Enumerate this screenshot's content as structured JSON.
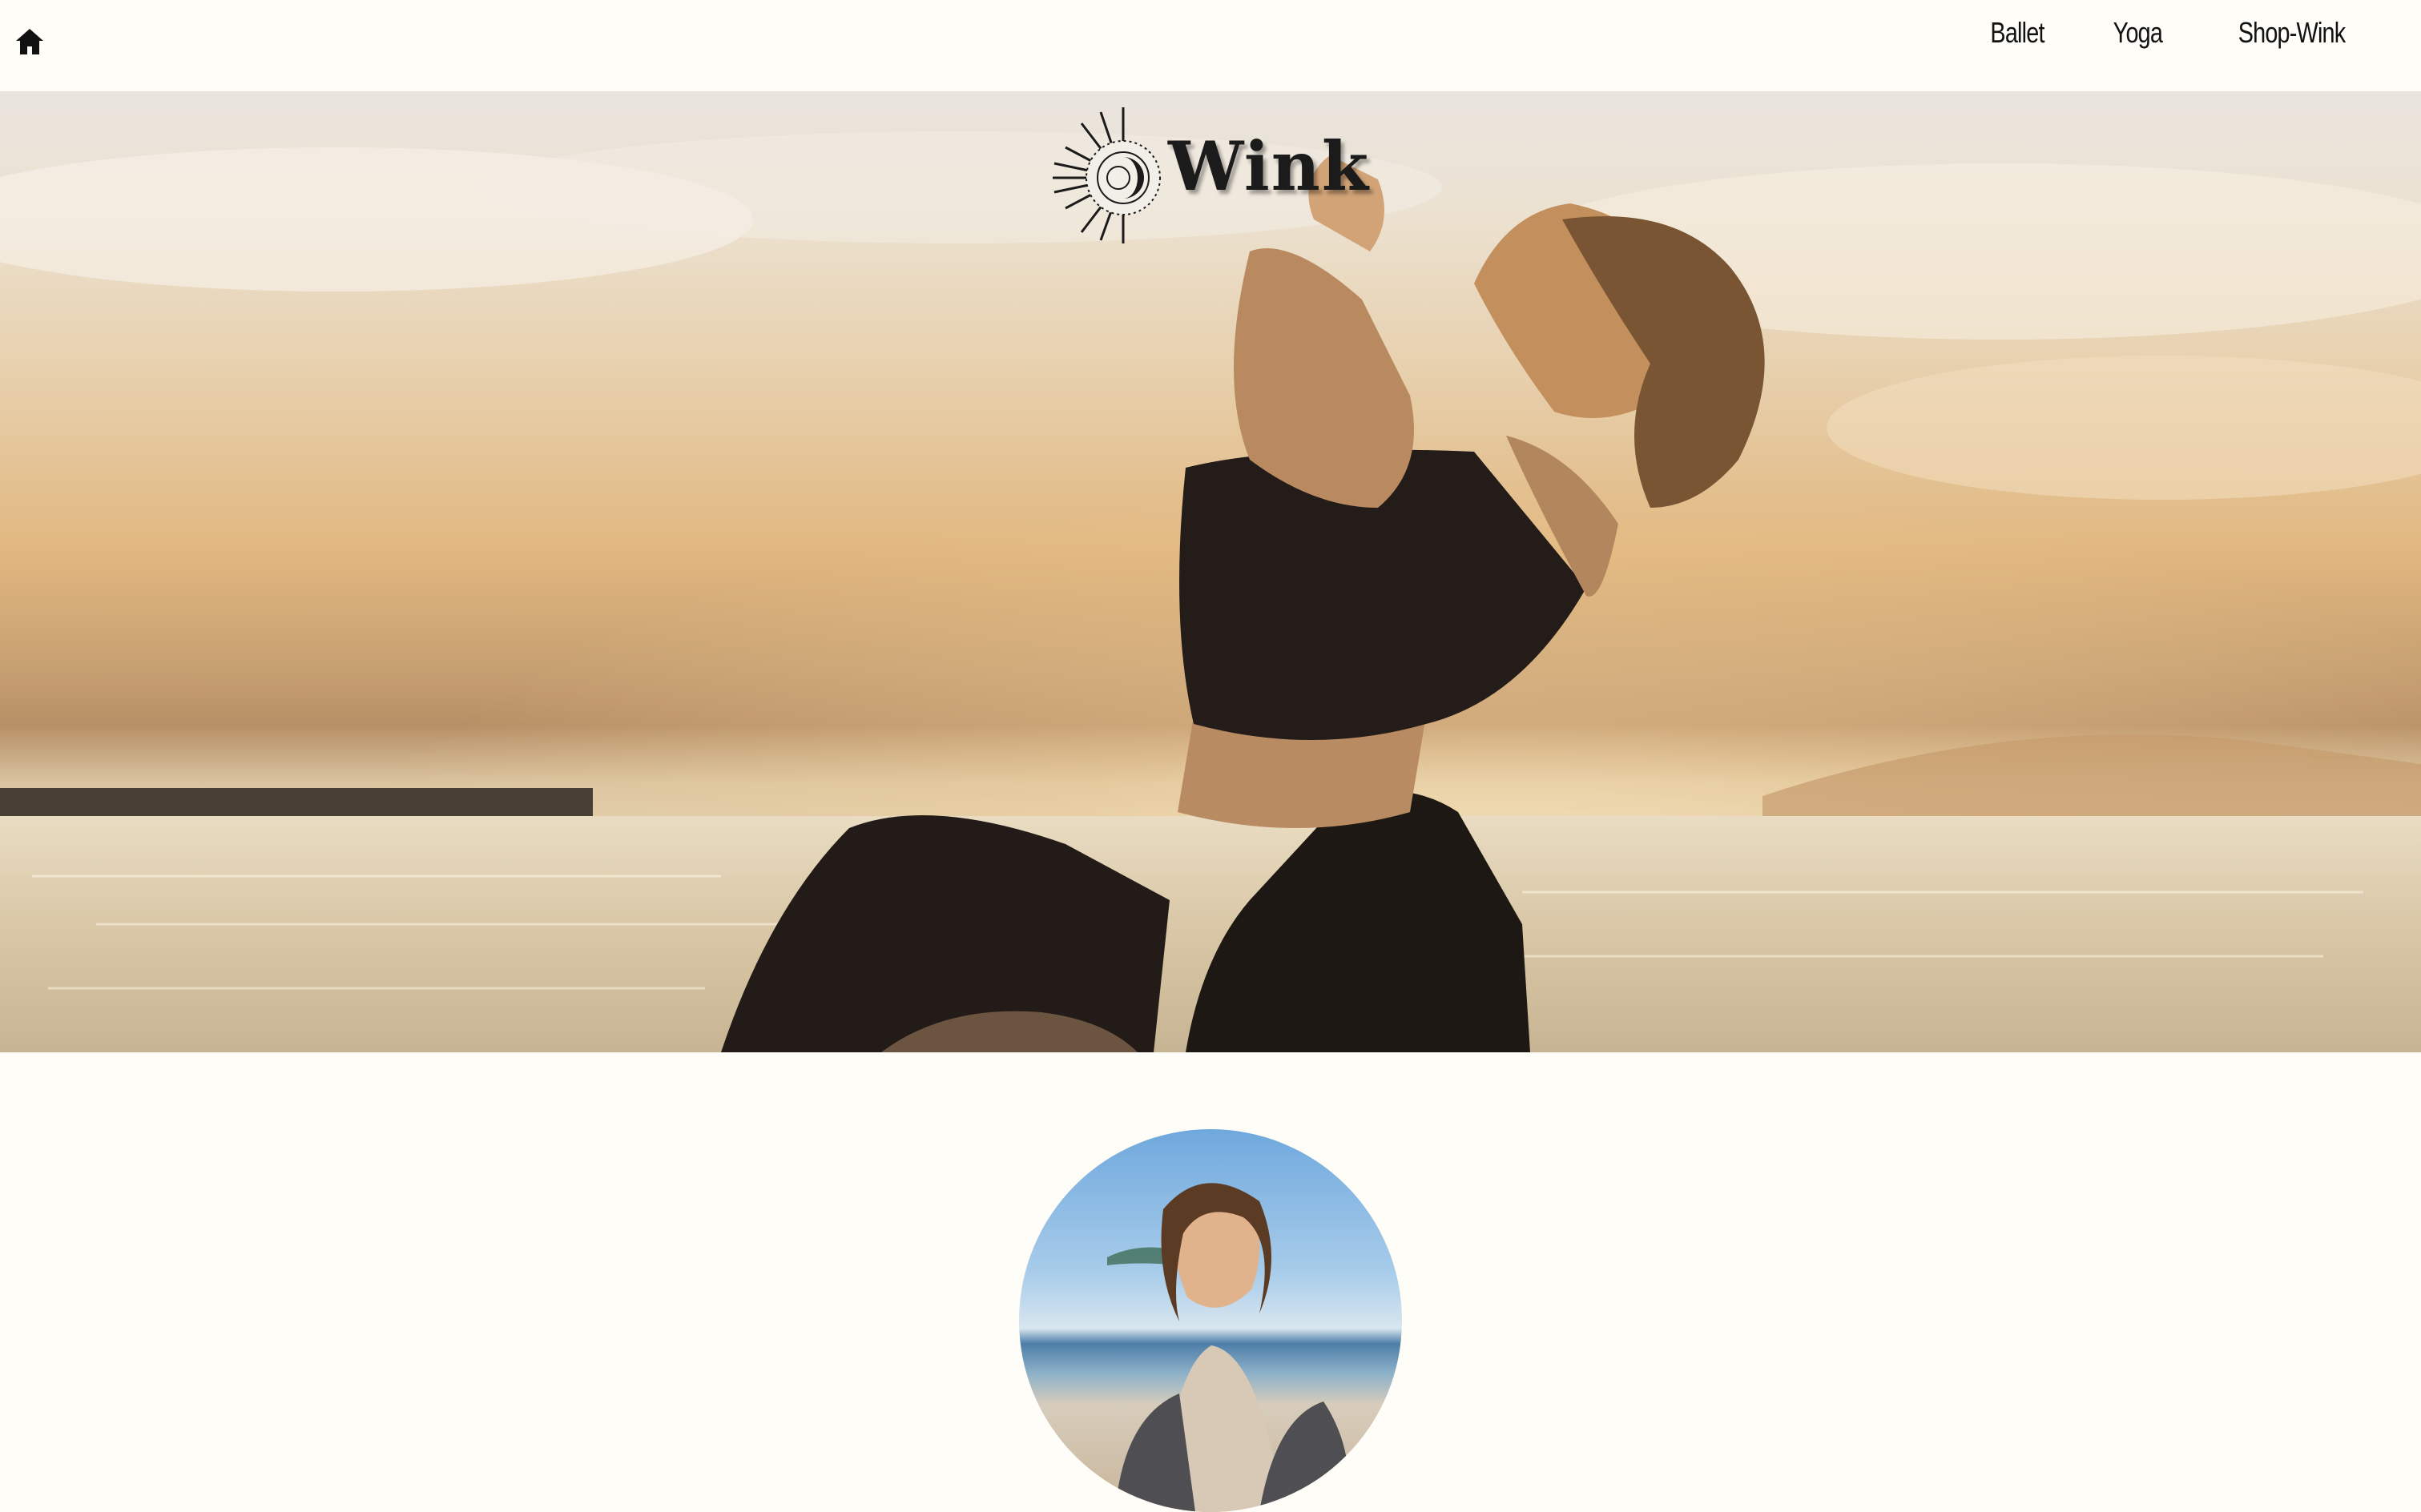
{
  "header": {
    "home_icon": "home-icon",
    "nav": [
      {
        "label": "Ballet"
      },
      {
        "label": "Yoga"
      },
      {
        "label": "Shop-Wink"
      }
    ]
  },
  "hero": {
    "logo_text": "Wink",
    "logo_icon": "sun-moon-icon",
    "image_description": "sunset-yoga-photo"
  },
  "profile": {
    "avatar": "avatar-photo"
  }
}
